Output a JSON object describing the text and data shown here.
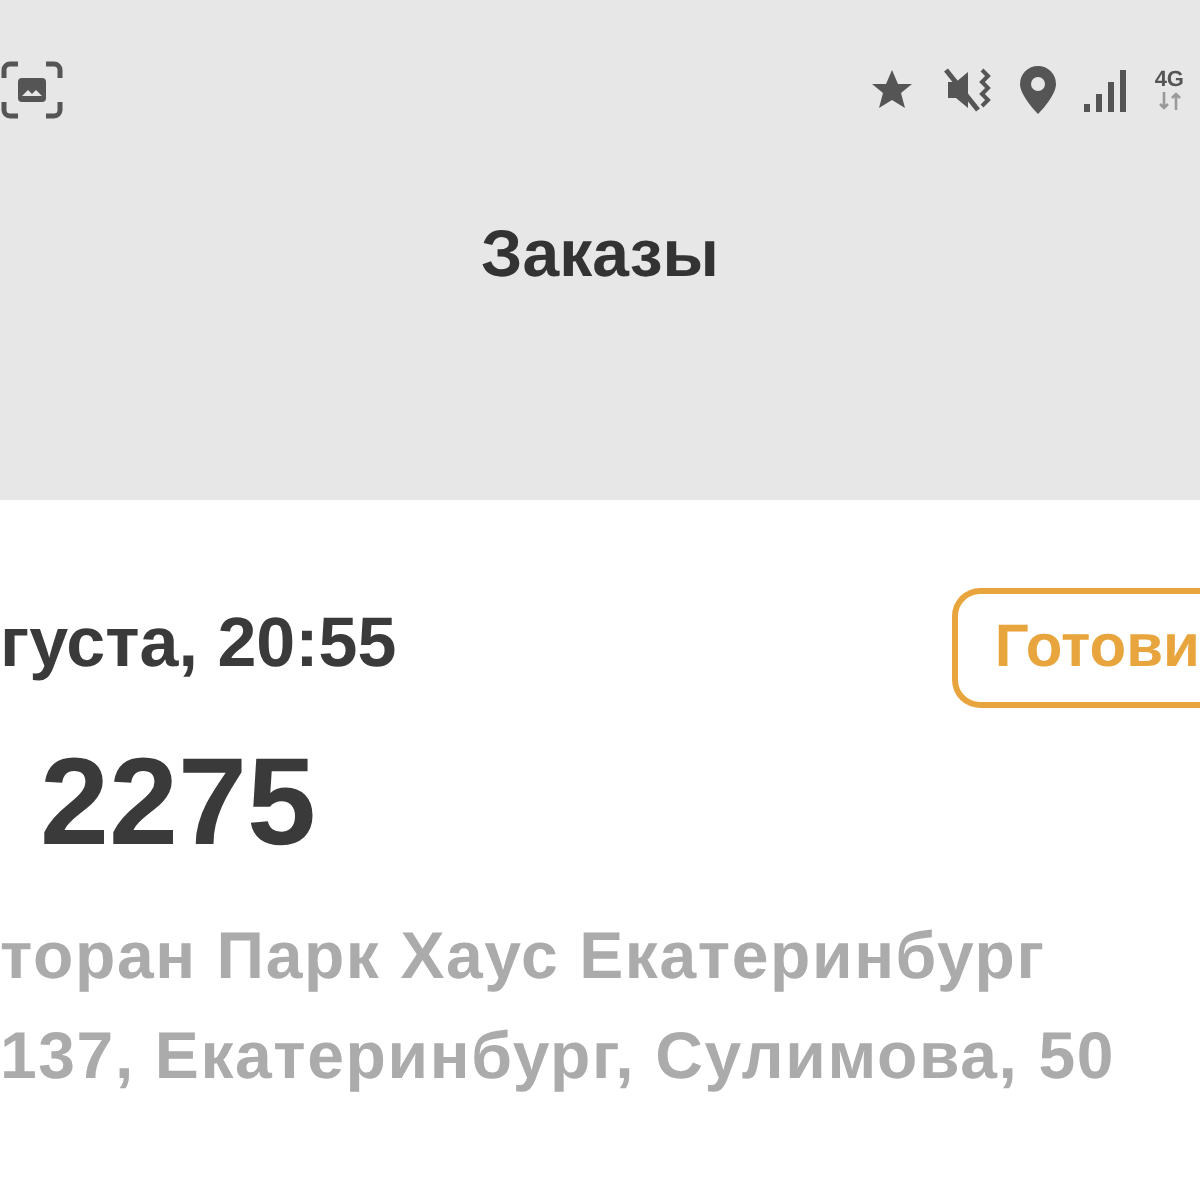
{
  "status_bar": {
    "network": "4G"
  },
  "header": {
    "title": "Заказы"
  },
  "order": {
    "date": "густа, 20:55",
    "number": "2275",
    "status": "Готови",
    "restaurant": "торан Парк Хаус Екатеринбург",
    "address": "137, Екатеринбург, Сулимова, 50"
  }
}
